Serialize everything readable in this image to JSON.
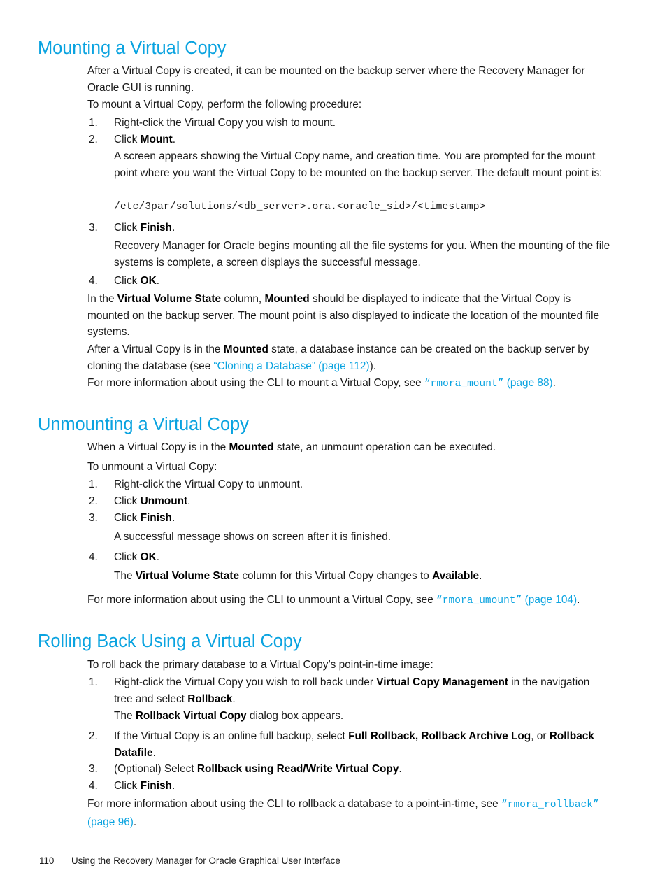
{
  "page": {
    "number": "110",
    "footer_title": "Using the Recovery Manager for Oracle Graphical User Interface",
    "heading_color": "#0aa3e0",
    "body_color": "#1a1a1a"
  },
  "sections": [
    {
      "id": "mounting",
      "heading": "Mounting a Virtual Copy",
      "intro_1": "After a Virtual Copy is created, it can be mounted on the backup server where the Recovery Manager for Oracle GUI is running.",
      "intro_2": "To mount a Virtual Copy, perform the following procedure:",
      "steps": [
        {
          "num": "1.",
          "pre": "Right-click the Virtual Copy you wish to mount.",
          "bold": "",
          "post": ""
        },
        {
          "num": "2.",
          "pre": "Click ",
          "bold": "Mount",
          "post": "."
        },
        {
          "num": "3.",
          "pre": "Click ",
          "bold": "Finish",
          "post": "."
        },
        {
          "num": "4.",
          "pre": "Click ",
          "bold": "OK",
          "post": "."
        }
      ],
      "step2_detail": "A screen appears showing the Virtual Copy name, and creation time. You are prompted for the mount point where you want the Virtual Copy to be mounted on the backup server. The default mount point is:",
      "code_path": "/etc/3par/solutions/<db_server>.ora.<oracle_sid>/<timestamp>",
      "step3_detail": "Recovery Manager for Oracle begins mounting all the file systems for you. When the mounting of the file systems is complete, a screen displays the successful message.",
      "closing_1_a": "In the ",
      "closing_1_b1": "Virtual Volume State",
      "closing_1_c": " column, ",
      "closing_1_b2": "Mounted",
      "closing_1_d": " should be displayed to indicate that the Virtual Copy is mounted on the backup server. The mount point is also displayed to indicate the location of the mounted file systems.",
      "closing_2_a": "After a Virtual Copy is in the ",
      "closing_2_b": "Mounted",
      "closing_2_c": " state, a database instance can be created on the backup server by cloning the database (see ",
      "closing_2_link": "“Cloning a Database” (page 112)",
      "closing_2_d": ").",
      "cli_note_a": "For more information about using the CLI to mount a Virtual Copy, see ",
      "cli_note_link_mono": "“rmora_mount”",
      "cli_note_link_rest": " (page 88)",
      "cli_note_b": "."
    },
    {
      "id": "unmounting",
      "heading": "Unmounting a Virtual Copy",
      "intro_1_a": "When a Virtual Copy is in the ",
      "intro_1_b": "Mounted",
      "intro_1_c": " state, an unmount operation can be executed.",
      "intro_2": "To unmount a Virtual Copy:",
      "steps": [
        {
          "num": "1.",
          "pre": "Right-click the Virtual Copy to unmount.",
          "bold": "",
          "post": ""
        },
        {
          "num": "2.",
          "pre": "Click ",
          "bold": "Unmount",
          "post": "."
        },
        {
          "num": "3.",
          "pre": "Click ",
          "bold": "Finish",
          "post": "."
        },
        {
          "num": "4.",
          "pre": "Click ",
          "bold": "OK",
          "post": "."
        }
      ],
      "step3_detail": "A successful message shows on screen after it is finished.",
      "step4_detail_a": "The ",
      "step4_detail_b1": "Virtual Volume State",
      "step4_detail_c": " column for this Virtual Copy changes to ",
      "step4_detail_b2": "Available",
      "step4_detail_d": ".",
      "cli_note_a": "For more information about using the CLI to unmount a Virtual Copy, see ",
      "cli_note_link_mono": "“rmora_umount”",
      "cli_note_link_rest": " (page 104)",
      "cli_note_b": "."
    },
    {
      "id": "rollback",
      "heading": "Rolling Back Using a Virtual Copy",
      "intro_1": "To roll back the primary database to a Virtual Copy’s point-in-time image:",
      "step1_a": "Right-click the Virtual Copy you wish to roll back under ",
      "step1_b1": "Virtual Copy Management",
      "step1_c": " in the navigation tree and select ",
      "step1_b2": "Rollback",
      "step1_d": ".",
      "step1_detail_a": "The ",
      "step1_detail_b": "Rollback Virtual Copy",
      "step1_detail_c": " dialog box appears.",
      "step2_a": "If the Virtual Copy is an online full backup, select ",
      "step2_b1": "Full Rollback, Rollback Archive Log",
      "step2_c": ", or ",
      "step2_b2": "Rollback Datafile",
      "step2_d": ".",
      "step3_a": "(Optional) Select ",
      "step3_b": "Rollback using Read/Write Virtual Copy",
      "step3_c": ".",
      "step4_a": "Click ",
      "step4_b": "Finish",
      "step4_c": ".",
      "nums": {
        "one": "1.",
        "two": "2.",
        "three": "3.",
        "four": "4."
      },
      "cli_note_a": "For more information about using the CLI to rollback a database to a point-in-time, see ",
      "cli_note_link_mono": "“rmora_rollback”",
      "cli_note_link_rest": " (page 96)",
      "cli_note_b": "."
    }
  ]
}
